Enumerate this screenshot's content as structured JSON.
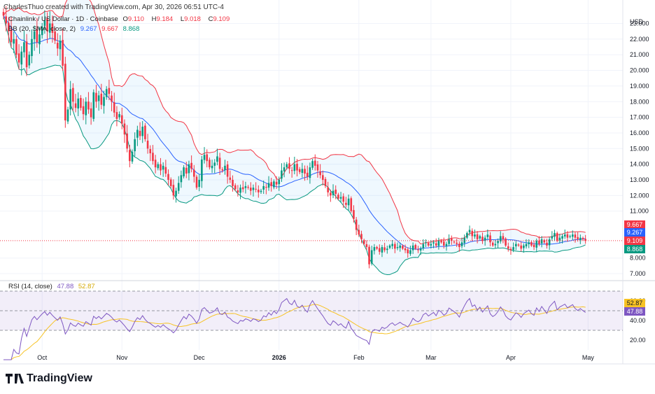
{
  "credit": "CharlesThuo created with TradingView.com, Apr 30, 2026 06:51 UTC-4",
  "legend": {
    "symbol": "Chainlink / US Dollar · 1D · Coinbase",
    "o_label": "O",
    "o": "9.110",
    "h_label": "H",
    "h": "9.184",
    "l_label": "L",
    "l": "9.018",
    "c_label": "C",
    "c": "9.109",
    "bb_label": "BB (20, SMA, close, 2)",
    "bb_basis": "9.267",
    "bb_upper": "9.667",
    "bb_lower": "8.868",
    "rsi_label": "RSI (14, close)",
    "rsi_value": "47.88",
    "rsi_ma": "52.87"
  },
  "currency": "USD",
  "logo_text": "TradingView",
  "colors": {
    "up": "#089981",
    "down": "#f23645",
    "basis": "#2962ff",
    "upper": "#f23645",
    "lower": "#089981",
    "rsi": "#7e57c2",
    "rsi_ma": "#f7c325"
  },
  "chart_data": {
    "type": "candlestick",
    "start_date": "2025-09-16",
    "closes": [
      23.5,
      23,
      22.5,
      21.8,
      22,
      21,
      20.5,
      21.2,
      21.8,
      20.2,
      21,
      22,
      22.5,
      21.8,
      22.3,
      22.8,
      23.2,
      22.5,
      23.0,
      22.4,
      21.9,
      21.4,
      21.9,
      20.3,
      16.8,
      17.5,
      18.8,
      18.0,
      17.6,
      18.2,
      17.6,
      17.2,
      18.0,
      17.5,
      17.0,
      18.6,
      18.0,
      18.4,
      17.8,
      18.3,
      18.8,
      18.5,
      18.0,
      17.3,
      16.9,
      17.2,
      16.6,
      15.9,
      15.0,
      14.2,
      14.8,
      15.6,
      16.2,
      15.8,
      16.4,
      15.6,
      15.0,
      14.7,
      14.2,
      13.8,
      14.0,
      13.6,
      13.9,
      13.4,
      13.0,
      12.6,
      12.0,
      12.3,
      12.8,
      13.3,
      13.8,
      13.4,
      14.0,
      13.7,
      13.2,
      12.5,
      13.0,
      14.3,
      14.6,
      14.2,
      13.8,
      13.9,
      14.1,
      14.5,
      13.7,
      13.6,
      13.9,
      13.2,
      13.0,
      12.6,
      12.4,
      12.2,
      12.5,
      12.4,
      12.6,
      12.5,
      12.3,
      12.5,
      12.4,
      12.2,
      12.3,
      12.6,
      12.5,
      12.8,
      12.6,
      12.9,
      12.7,
      13.0,
      13.6,
      13.8,
      14.0,
      13.7,
      13.6,
      14.0,
      13.6,
      13.5,
      13.7,
      13.4,
      13.2,
      13.8,
      14.2,
      13.9,
      13.6,
      13.3,
      13.0,
      12.6,
      12.2,
      12.0,
      12.3,
      12.1,
      11.8,
      11.9,
      11.6,
      11.4,
      11.8,
      11.0,
      10.5,
      9.8,
      9.5,
      9.2,
      8.9,
      8.7,
      7.6,
      8.5,
      8.7,
      8.6,
      8.4,
      8.7,
      8.5,
      8.6,
      8.8,
      8.9,
      8.6,
      8.7,
      8.8,
      8.6,
      8.5,
      8.3,
      8.5,
      8.8,
      8.6,
      8.5,
      8.6,
      8.9,
      9.0,
      8.8,
      8.9,
      9.0,
      8.8,
      9.1,
      9.0,
      8.8,
      8.9,
      9.2,
      9.1,
      9.0,
      8.9,
      8.7,
      9.0,
      9.3,
      9.6,
      9.8,
      9.4,
      9.5,
      9.2,
      9.4,
      9.1,
      9.3,
      9.5,
      9.0,
      8.8,
      8.9,
      9.1,
      9.4,
      9.2,
      8.8,
      8.6,
      8.5,
      8.7,
      8.9,
      8.8,
      8.6,
      8.8,
      8.9,
      9.0,
      8.8,
      8.7,
      9.1,
      8.9,
      9.2,
      9.0,
      8.8,
      9.2,
      9.4,
      9.6,
      9.1,
      9.3,
      9.4,
      9.5,
      9.3,
      9.4,
      9.5,
      9.3,
      9.2,
      9.3,
      9.2,
      9.109
    ],
    "price_ticks": [
      "23.000",
      "22.000",
      "21.000",
      "20.000",
      "19.000",
      "18.000",
      "17.000",
      "16.000",
      "15.000",
      "14.000",
      "13.000",
      "12.000",
      "11.000",
      "8.000",
      "7.000"
    ],
    "price_range": [
      6.6,
      24.5
    ],
    "rsi_ticks": [
      "60.00",
      "40.00",
      "20.00"
    ],
    "rsi_range": [
      10,
      80
    ],
    "rsi_bands": [
      70,
      30
    ],
    "x_labels": [
      {
        "label": "Oct",
        "day": 15
      },
      {
        "label": "Nov",
        "day": 46
      },
      {
        "label": "Dec",
        "day": 76
      },
      {
        "label": "2026",
        "day": 107
      },
      {
        "label": "Feb",
        "day": 138
      },
      {
        "label": "Mar",
        "day": 166
      },
      {
        "label": "Apr",
        "day": 197
      },
      {
        "label": "May",
        "day": 227
      }
    ]
  }
}
